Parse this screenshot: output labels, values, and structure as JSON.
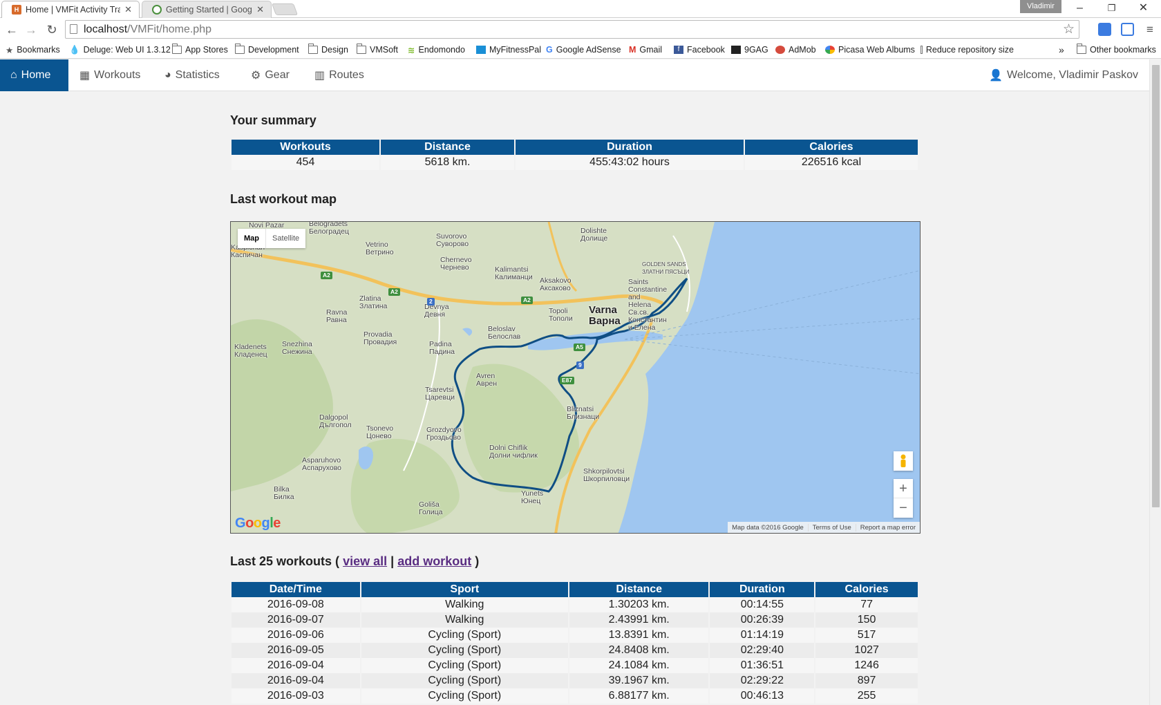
{
  "browser": {
    "tabs": [
      {
        "title": "Home | VMFit Activity Tracker",
        "active": true,
        "favicon_color": "#d86b2b"
      },
      {
        "title": "Getting Started | Google Maps",
        "active": false,
        "favicon_color": "#4a8f3c"
      }
    ],
    "profile_name": "Vladimir",
    "url_host": "localhost",
    "url_path": "/VMFit/home.php",
    "bookmarks": [
      {
        "label": "Bookmarks",
        "icon": "star-icon"
      },
      {
        "label": "Deluge: Web UI 1.3.12",
        "icon": "deluge-icon"
      },
      {
        "label": "App Stores",
        "icon": "folder-icon"
      },
      {
        "label": "Development",
        "icon": "folder-icon"
      },
      {
        "label": "Design",
        "icon": "folder-icon"
      },
      {
        "label": "VMSoft",
        "icon": "folder-icon"
      },
      {
        "label": "Endomondo",
        "icon": "endomondo-icon"
      },
      {
        "label": "MyFitnessPal",
        "icon": "myfitnesspal-icon"
      },
      {
        "label": "Google AdSense",
        "icon": "google-icon"
      },
      {
        "label": "Gmail",
        "icon": "gmail-icon"
      },
      {
        "label": "Facebook",
        "icon": "facebook-icon"
      },
      {
        "label": "9GAG",
        "icon": "9gag-icon"
      },
      {
        "label": "AdMob",
        "icon": "admob-icon"
      },
      {
        "label": "Picasa Web Albums",
        "icon": "picasa-icon"
      },
      {
        "label": "Reduce repository size",
        "icon": "page-icon"
      }
    ],
    "overflow": "»",
    "other_bookmarks": "Other bookmarks"
  },
  "nav": {
    "items": [
      {
        "label": "Home",
        "icon": "home-icon",
        "active": true
      },
      {
        "label": "Workouts",
        "icon": "calendar-icon"
      },
      {
        "label": "Statistics",
        "icon": "pie-chart-icon"
      },
      {
        "label": "Gear",
        "icon": "gears-icon"
      },
      {
        "label": "Routes",
        "icon": "map-icon"
      }
    ],
    "welcome": "Welcome, Vladimir Paskov"
  },
  "summary": {
    "title": "Your summary",
    "headers": [
      "Workouts",
      "Distance",
      "Duration",
      "Calories"
    ],
    "values": [
      "454",
      "5618 km.",
      "455:43:02 hours",
      "226516 kcal"
    ]
  },
  "map": {
    "title": "Last workout map",
    "type_map": "Map",
    "type_satellite": "Satellite",
    "attribution": [
      "Map data ©2016 Google",
      "Terms of Use",
      "Report a map error"
    ],
    "logo": "Google",
    "zoom_in": "+",
    "zoom_out": "−",
    "colors": {
      "land": "#d6dfc4",
      "sea": "#9fc6f0",
      "route": "#0f4e84",
      "road": "#f2c25b"
    },
    "labels": [
      {
        "text": "Novi Pazar",
        "sub": "",
        "major": false
      },
      {
        "text": "Belogradets",
        "sub": "Белоградец",
        "major": false
      },
      {
        "text": "Kaspichan",
        "sub": "Каспичан",
        "major": false
      },
      {
        "text": "Vetrino",
        "sub": "Ветрино",
        "major": false
      },
      {
        "text": "Suvorovo",
        "sub": "Суворово",
        "major": false
      },
      {
        "text": "Dolishte",
        "sub": "Долище",
        "major": false
      },
      {
        "text": "Chernevo",
        "sub": "Чернево",
        "major": false
      },
      {
        "text": "Kalimantsi",
        "sub": "Калиманци",
        "major": false
      },
      {
        "text": "Aksakovo",
        "sub": "Аксаково",
        "major": false
      },
      {
        "text": "GOLDEN SANDS",
        "sub": "ЗЛАТНИ ПЯСЪЦИ",
        "major": false
      },
      {
        "text": "Saints Constantine and Helena",
        "sub": "Св.св. Константин и Елена",
        "major": false
      },
      {
        "text": "Zlatina",
        "sub": "Златина",
        "major": false
      },
      {
        "text": "Devnya",
        "sub": "Девня",
        "major": false
      },
      {
        "text": "Topoli",
        "sub": "Тополи",
        "major": false
      },
      {
        "text": "Varna",
        "sub": "Варна",
        "major": true
      },
      {
        "text": "Ravna",
        "sub": "Равна",
        "major": false
      },
      {
        "text": "Beloslav",
        "sub": "Белослав",
        "major": false
      },
      {
        "text": "Provadia",
        "sub": "Провадия",
        "major": false
      },
      {
        "text": "Padina",
        "sub": "Падина",
        "major": false
      },
      {
        "text": "Snezhina",
        "sub": "Снежина",
        "major": false
      },
      {
        "text": "Kladenets",
        "sub": "Кладенец",
        "major": false
      },
      {
        "text": "Avren",
        "sub": "Аврен",
        "major": false
      },
      {
        "text": "Tsarevtsi",
        "sub": "Царевци",
        "major": false
      },
      {
        "text": "Bliznatsi",
        "sub": "Близнаци",
        "major": false
      },
      {
        "text": "Dalgopol",
        "sub": "Дългопол",
        "major": false
      },
      {
        "text": "Tsonevo",
        "sub": "Цонево",
        "major": false
      },
      {
        "text": "Grozdyovo",
        "sub": "Гроздьово",
        "major": false
      },
      {
        "text": "Dolni Chiflik",
        "sub": "Долни чифлик",
        "major": false
      },
      {
        "text": "Asparuhovo",
        "sub": "Аспарухово",
        "major": false
      },
      {
        "text": "Shkorpilovtsi",
        "sub": "Шкорпиловци",
        "major": false
      },
      {
        "text": "Bilka",
        "sub": "Билка",
        "major": false
      },
      {
        "text": "Yunets",
        "sub": "Юнец",
        "major": false
      },
      {
        "text": "Goliša",
        "sub": "Голица",
        "major": false
      }
    ],
    "road_badges": [
      "A2",
      "A2",
      "A2",
      "2",
      "A5",
      "E87",
      "9"
    ]
  },
  "workouts": {
    "title_prefix": "Last 25 workouts (",
    "view_all": "view all",
    "separator": "|",
    "add_workout": "add workout",
    "title_suffix": ")",
    "headers": [
      "Date/Time",
      "Sport",
      "Distance",
      "Duration",
      "Calories"
    ],
    "rows": [
      [
        "2016-09-08",
        "Walking",
        "1.30203 km.",
        "00:14:55",
        "77"
      ],
      [
        "2016-09-07",
        "Walking",
        "2.43991 km.",
        "00:26:39",
        "150"
      ],
      [
        "2016-09-06",
        "Cycling (Sport)",
        "13.8391 km.",
        "01:14:19",
        "517"
      ],
      [
        "2016-09-05",
        "Cycling (Sport)",
        "24.8408 km.",
        "02:29:40",
        "1027"
      ],
      [
        "2016-09-04",
        "Cycling (Sport)",
        "24.1084 km.",
        "01:36:51",
        "1246"
      ],
      [
        "2016-09-04",
        "Cycling (Sport)",
        "39.1967 km.",
        "02:29:22",
        "897"
      ],
      [
        "2016-09-03",
        "Cycling (Sport)",
        "6.88177 km.",
        "00:46:13",
        "255"
      ]
    ]
  }
}
